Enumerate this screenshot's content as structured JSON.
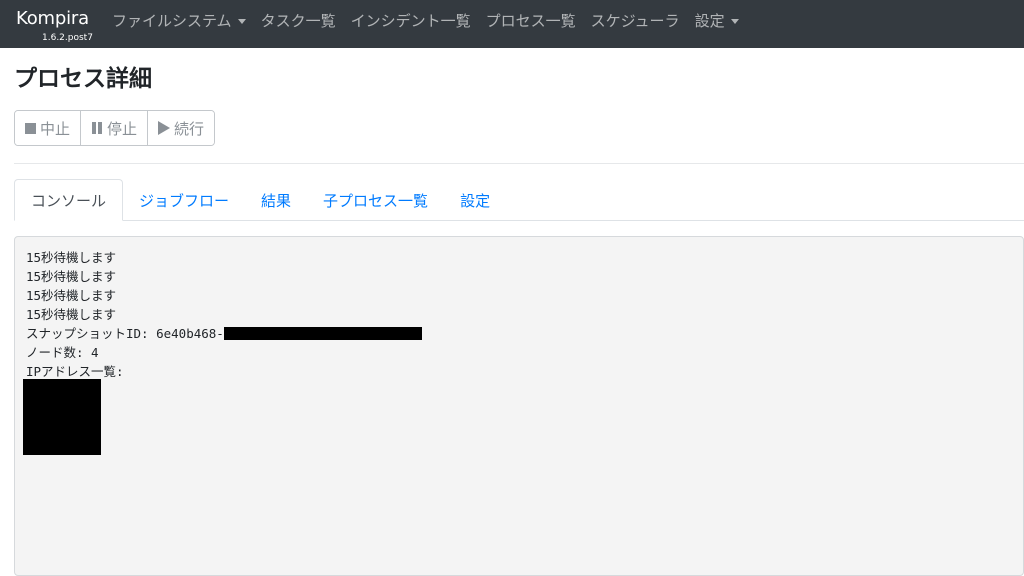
{
  "navbar": {
    "brand": "Kompira",
    "version": "1.6.2.post7",
    "items": [
      {
        "label": "ファイルシステム",
        "dropdown": true
      },
      {
        "label": "タスク一覧",
        "dropdown": false
      },
      {
        "label": "インシデント一覧",
        "dropdown": false
      },
      {
        "label": "プロセス一覧",
        "dropdown": false
      },
      {
        "label": "スケジューラ",
        "dropdown": false
      },
      {
        "label": "設定",
        "dropdown": true
      }
    ]
  },
  "page": {
    "title": "プロセス詳細"
  },
  "toolbar": {
    "abort_label": "中止",
    "abort_icon": "stop-icon",
    "pause_label": "停止",
    "pause_icon": "pause-icon",
    "resume_label": "続行",
    "resume_icon": "play-icon"
  },
  "tabs": [
    {
      "label": "コンソール",
      "active": true
    },
    {
      "label": "ジョブフロー",
      "active": false
    },
    {
      "label": "結果",
      "active": false
    },
    {
      "label": "子プロセス一覧",
      "active": false
    },
    {
      "label": "設定",
      "active": false
    }
  ],
  "console": {
    "lines": [
      "15秒待機します",
      "15秒待機します",
      "15秒待機します",
      "15秒待機します",
      "スナップショットID: 6e40b468-",
      "ノード数: 4",
      "IPアドレス一覧:"
    ]
  },
  "colors": {
    "navbar_bg": "#343a40",
    "link": "#007bff",
    "console_bg": "#f4f4f4"
  }
}
